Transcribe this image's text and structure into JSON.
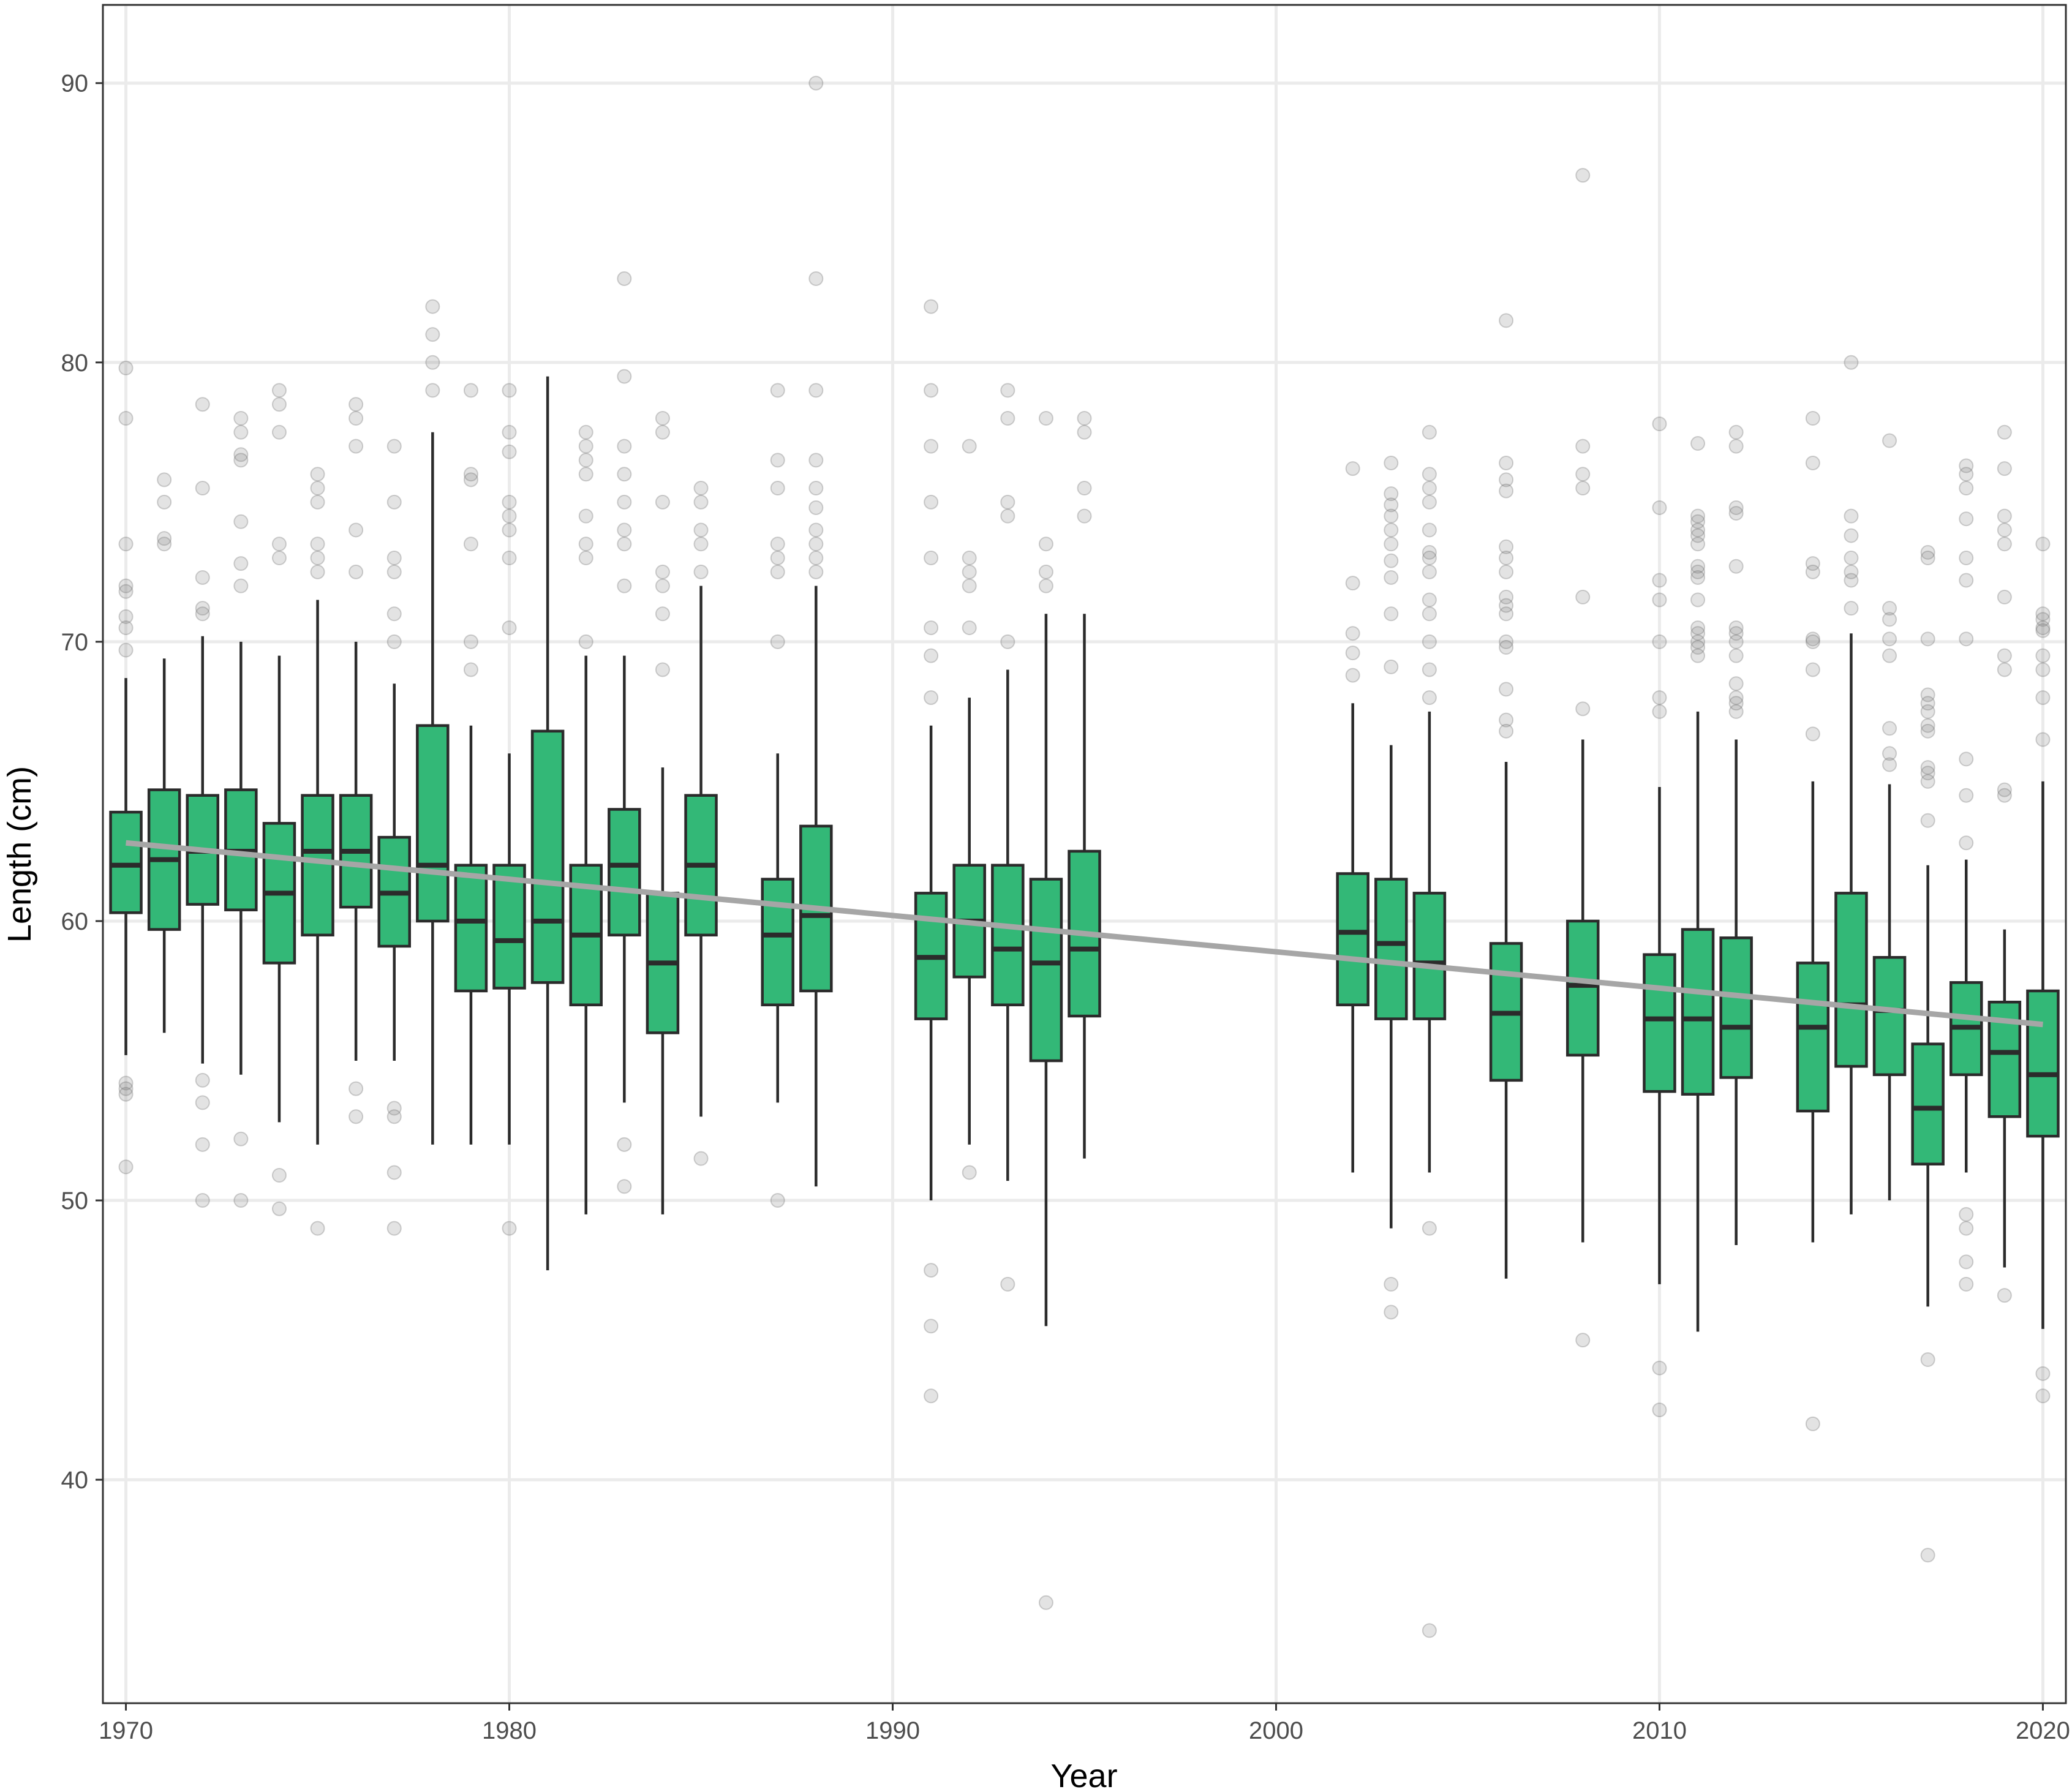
{
  "chart_data": {
    "type": "box",
    "title": "",
    "xlabel": "Year",
    "ylabel": "Length (cm)",
    "xlim": [
      1969.4,
      2020.6
    ],
    "ylim": [
      32,
      92.8
    ],
    "x_ticks": [
      1970,
      1980,
      1990,
      2000,
      2010,
      2020
    ],
    "y_ticks": [
      40,
      50,
      60,
      70,
      80,
      90
    ],
    "grid": true,
    "legend": "none",
    "colors": {
      "box_fill": "#33b877",
      "box_line": "#2b2b2b",
      "trend": "#a6a6a6",
      "outlier": "#bdbdbd",
      "grid": "#ebebeb",
      "panel_border": "#333333"
    },
    "boxes": [
      {
        "year": 1970,
        "q1": 60.3,
        "median": 62.0,
        "q3": 63.9,
        "whisker_low": 55.2,
        "whisker_high": 68.7
      },
      {
        "year": 1971,
        "q1": 59.7,
        "median": 62.2,
        "q3": 64.7,
        "whisker_low": 56.0,
        "whisker_high": 69.4
      },
      {
        "year": 1972,
        "q1": 60.6,
        "median": 62.5,
        "q3": 64.5,
        "whisker_low": 54.9,
        "whisker_high": 70.2
      },
      {
        "year": 1973,
        "q1": 60.4,
        "median": 62.5,
        "q3": 64.7,
        "whisker_low": 54.5,
        "whisker_high": 70.0
      },
      {
        "year": 1974,
        "q1": 58.5,
        "median": 61.0,
        "q3": 63.5,
        "whisker_low": 52.8,
        "whisker_high": 69.5
      },
      {
        "year": 1975,
        "q1": 59.5,
        "median": 62.5,
        "q3": 64.5,
        "whisker_low": 52.0,
        "whisker_high": 71.5
      },
      {
        "year": 1976,
        "q1": 60.5,
        "median": 62.5,
        "q3": 64.5,
        "whisker_low": 55.0,
        "whisker_high": 70.0
      },
      {
        "year": 1977,
        "q1": 59.1,
        "median": 61.0,
        "q3": 63.0,
        "whisker_low": 55.0,
        "whisker_high": 68.5
      },
      {
        "year": 1978,
        "q1": 60.0,
        "median": 62.0,
        "q3": 67.0,
        "whisker_low": 52.0,
        "whisker_high": 77.5
      },
      {
        "year": 1979,
        "q1": 57.5,
        "median": 60.0,
        "q3": 62.0,
        "whisker_low": 52.0,
        "whisker_high": 67.0
      },
      {
        "year": 1980,
        "q1": 57.6,
        "median": 59.3,
        "q3": 62.0,
        "whisker_low": 52.0,
        "whisker_high": 66.0
      },
      {
        "year": 1981,
        "q1": 57.8,
        "median": 60.0,
        "q3": 66.8,
        "whisker_low": 47.5,
        "whisker_high": 79.5
      },
      {
        "year": 1982,
        "q1": 57.0,
        "median": 59.5,
        "q3": 62.0,
        "whisker_low": 49.5,
        "whisker_high": 69.5
      },
      {
        "year": 1983,
        "q1": 59.5,
        "median": 62.0,
        "q3": 64.0,
        "whisker_low": 53.5,
        "whisker_high": 69.5
      },
      {
        "year": 1984,
        "q1": 56.0,
        "median": 58.5,
        "q3": 61.0,
        "whisker_low": 49.5,
        "whisker_high": 65.5
      },
      {
        "year": 1985,
        "q1": 59.5,
        "median": 62.0,
        "q3": 64.5,
        "whisker_low": 53.0,
        "whisker_high": 72.0
      },
      {
        "year": 1987,
        "q1": 57.0,
        "median": 59.5,
        "q3": 61.5,
        "whisker_low": 53.5,
        "whisker_high": 66.0
      },
      {
        "year": 1988,
        "q1": 57.5,
        "median": 60.2,
        "q3": 63.4,
        "whisker_low": 50.5,
        "whisker_high": 72.0
      },
      {
        "year": 1991,
        "q1": 56.5,
        "median": 58.7,
        "q3": 61.0,
        "whisker_low": 50.0,
        "whisker_high": 67.0
      },
      {
        "year": 1992,
        "q1": 58.0,
        "median": 60.0,
        "q3": 62.0,
        "whisker_low": 52.0,
        "whisker_high": 68.0
      },
      {
        "year": 1993,
        "q1": 57.0,
        "median": 59.0,
        "q3": 62.0,
        "whisker_low": 50.7,
        "whisker_high": 69.0
      },
      {
        "year": 1994,
        "q1": 55.0,
        "median": 58.5,
        "q3": 61.5,
        "whisker_low": 45.5,
        "whisker_high": 71.0
      },
      {
        "year": 1995,
        "q1": 56.6,
        "median": 59.0,
        "q3": 62.5,
        "whisker_low": 51.5,
        "whisker_high": 71.0
      },
      {
        "year": 2002,
        "q1": 57.0,
        "median": 59.6,
        "q3": 61.7,
        "whisker_low": 51.0,
        "whisker_high": 67.8
      },
      {
        "year": 2003,
        "q1": 56.5,
        "median": 59.2,
        "q3": 61.5,
        "whisker_low": 49.0,
        "whisker_high": 66.3
      },
      {
        "year": 2004,
        "q1": 56.5,
        "median": 58.5,
        "q3": 61.0,
        "whisker_low": 51.0,
        "whisker_high": 67.5
      },
      {
        "year": 2006,
        "q1": 54.3,
        "median": 56.7,
        "q3": 59.2,
        "whisker_low": 47.2,
        "whisker_high": 65.7
      },
      {
        "year": 2008,
        "q1": 55.2,
        "median": 57.7,
        "q3": 60.0,
        "whisker_low": 48.5,
        "whisker_high": 66.5
      },
      {
        "year": 2010,
        "q1": 53.9,
        "median": 56.5,
        "q3": 58.8,
        "whisker_low": 47.0,
        "whisker_high": 64.8
      },
      {
        "year": 2011,
        "q1": 53.8,
        "median": 56.5,
        "q3": 59.7,
        "whisker_low": 45.3,
        "whisker_high": 67.5
      },
      {
        "year": 2012,
        "q1": 54.4,
        "median": 56.2,
        "q3": 59.4,
        "whisker_low": 48.4,
        "whisker_high": 66.5
      },
      {
        "year": 2014,
        "q1": 53.2,
        "median": 56.2,
        "q3": 58.5,
        "whisker_low": 48.5,
        "whisker_high": 65.0
      },
      {
        "year": 2015,
        "q1": 54.8,
        "median": 57.0,
        "q3": 61.0,
        "whisker_low": 49.5,
        "whisker_high": 70.3
      },
      {
        "year": 2016,
        "q1": 54.5,
        "median": 56.8,
        "q3": 58.7,
        "whisker_low": 50.0,
        "whisker_high": 64.9
      },
      {
        "year": 2017,
        "q1": 51.3,
        "median": 53.3,
        "q3": 55.6,
        "whisker_low": 46.2,
        "whisker_high": 62.0
      },
      {
        "year": 2018,
        "q1": 54.5,
        "median": 56.2,
        "q3": 57.8,
        "whisker_low": 51.0,
        "whisker_high": 62.2
      },
      {
        "year": 2019,
        "q1": 53.0,
        "median": 55.3,
        "q3": 57.1,
        "whisker_low": 47.6,
        "whisker_high": 59.7
      },
      {
        "year": 2020,
        "q1": 52.3,
        "median": 54.5,
        "q3": 57.5,
        "whisker_low": 45.4,
        "whisker_high": 65.0
      }
    ],
    "outliers": [
      {
        "year": 1970,
        "values": [
          79.8,
          78.0,
          73.5,
          72.0,
          71.8,
          70.9,
          70.5,
          69.7,
          54.2,
          54.0,
          53.8,
          51.2
        ]
      },
      {
        "year": 1971,
        "values": [
          75.8,
          75.0,
          73.7,
          73.5
        ]
      },
      {
        "year": 1972,
        "values": [
          78.5,
          75.5,
          72.3,
          71.2,
          71.0,
          54.3,
          53.5,
          52.0,
          50.0
        ]
      },
      {
        "year": 1973,
        "values": [
          78.0,
          77.5,
          76.7,
          76.5,
          74.3,
          72.8,
          72.0,
          52.2,
          50.0
        ]
      },
      {
        "year": 1974,
        "values": [
          79.0,
          78.5,
          77.5,
          73.5,
          73.0,
          50.9,
          49.7
        ]
      },
      {
        "year": 1975,
        "values": [
          76.0,
          75.5,
          75.0,
          73.5,
          73.0,
          72.5,
          49.0
        ]
      },
      {
        "year": 1976,
        "values": [
          78.5,
          78.0,
          77.0,
          74.0,
          72.5,
          54.0,
          53.0
        ]
      },
      {
        "year": 1977,
        "values": [
          77.0,
          75.0,
          73.0,
          72.5,
          71.0,
          70.0,
          53.3,
          53.0,
          51.0,
          49.0
        ]
      },
      {
        "year": 1978,
        "values": [
          82.0,
          81.0,
          80.0,
          79.0
        ]
      },
      {
        "year": 1979,
        "values": [
          79.0,
          76.0,
          75.8,
          73.5,
          70.0,
          69.0
        ]
      },
      {
        "year": 1980,
        "values": [
          79.0,
          77.5,
          76.8,
          75.0,
          74.5,
          74.0,
          73.0,
          70.5,
          49.0
        ]
      },
      {
        "year": 1982,
        "values": [
          77.5,
          77.0,
          76.5,
          76.0,
          74.5,
          73.5,
          73.0,
          70.0
        ]
      },
      {
        "year": 1983,
        "values": [
          83.0,
          79.5,
          77.0,
          76.0,
          75.0,
          74.0,
          73.5,
          72.0,
          52.0,
          50.5
        ]
      },
      {
        "year": 1984,
        "values": [
          78.0,
          77.5,
          75.0,
          72.5,
          72.0,
          71.0,
          69.0
        ]
      },
      {
        "year": 1985,
        "values": [
          75.5,
          75.0,
          74.0,
          73.5,
          72.5,
          51.5
        ]
      },
      {
        "year": 1987,
        "values": [
          79.0,
          76.5,
          75.5,
          73.5,
          73.0,
          72.5,
          70.0,
          50.0
        ]
      },
      {
        "year": 1988,
        "values": [
          90.0,
          83.0,
          79.0,
          76.5,
          75.5,
          74.8,
          74.0,
          73.5,
          73.0,
          72.5
        ]
      },
      {
        "year": 1991,
        "values": [
          82.0,
          79.0,
          77.0,
          75.0,
          73.0,
          70.5,
          69.5,
          68.0,
          47.5,
          45.5,
          43.0
        ]
      },
      {
        "year": 1992,
        "values": [
          77.0,
          73.0,
          72.5,
          72.0,
          70.5,
          51.0
        ]
      },
      {
        "year": 1993,
        "values": [
          79.0,
          78.0,
          75.0,
          74.5,
          70.0,
          47.0
        ]
      },
      {
        "year": 1994,
        "values": [
          78.0,
          73.5,
          72.5,
          72.0,
          35.6
        ]
      },
      {
        "year": 1995,
        "values": [
          78.0,
          77.5,
          75.5,
          74.5
        ]
      },
      {
        "year": 2002,
        "values": [
          76.2,
          72.1,
          70.3,
          69.6,
          68.8
        ]
      },
      {
        "year": 2003,
        "values": [
          76.4,
          75.3,
          74.9,
          74.5,
          74.0,
          73.5,
          72.9,
          72.3,
          71.0,
          69.1,
          47.0,
          46.0
        ]
      },
      {
        "year": 2004,
        "values": [
          77.5,
          76.0,
          75.5,
          75.0,
          74.0,
          73.2,
          73.0,
          72.5,
          71.5,
          71.0,
          70.0,
          69.0,
          68.0,
          49.0,
          34.6
        ]
      },
      {
        "year": 2006,
        "values": [
          81.5,
          76.4,
          75.8,
          75.4,
          73.4,
          73.0,
          72.5,
          71.6,
          71.3,
          71.0,
          70.0,
          69.8,
          68.3,
          67.2,
          66.8
        ]
      },
      {
        "year": 2008,
        "values": [
          86.7,
          77.0,
          76.0,
          75.5,
          71.6,
          67.6,
          45.0
        ]
      },
      {
        "year": 2010,
        "values": [
          77.8,
          74.8,
          72.2,
          71.5,
          70.0,
          68.0,
          67.5,
          44.0,
          42.5
        ]
      },
      {
        "year": 2011,
        "values": [
          77.1,
          74.5,
          74.3,
          74.0,
          73.8,
          73.5,
          72.7,
          72.5,
          72.3,
          71.5,
          70.5,
          70.3,
          70.0,
          69.8,
          69.5
        ]
      },
      {
        "year": 2012,
        "values": [
          77.5,
          77.0,
          74.8,
          74.6,
          72.7,
          70.5,
          70.3,
          70.0,
          69.5,
          68.5,
          68.0,
          67.8,
          67.5
        ]
      },
      {
        "year": 2014,
        "values": [
          78.0,
          76.4,
          72.8,
          72.5,
          70.1,
          70.0,
          69.0,
          66.7,
          42.0
        ]
      },
      {
        "year": 2015,
        "values": [
          80.0,
          74.5,
          73.8,
          73.0,
          72.5,
          72.2,
          71.2
        ]
      },
      {
        "year": 2016,
        "values": [
          77.2,
          71.2,
          70.8,
          70.1,
          69.5,
          66.9,
          66.0,
          65.6
        ]
      },
      {
        "year": 2017,
        "values": [
          73.2,
          73.0,
          70.1,
          68.1,
          67.8,
          67.5,
          67.0,
          66.8,
          65.5,
          65.3,
          65.0,
          63.6,
          44.3,
          37.3
        ]
      },
      {
        "year": 2018,
        "values": [
          76.3,
          76.0,
          75.5,
          74.4,
          73.0,
          72.2,
          70.1,
          65.8,
          64.5,
          62.8,
          49.5,
          49.0,
          47.8,
          47.0
        ]
      },
      {
        "year": 2019,
        "values": [
          77.5,
          76.2,
          74.5,
          74.0,
          73.5,
          71.6,
          69.5,
          69.0,
          64.7,
          64.5,
          46.6
        ]
      },
      {
        "year": 2020,
        "values": [
          73.5,
          71.0,
          70.8,
          70.5,
          70.4,
          69.5,
          69.0,
          68.0,
          66.5,
          43.8,
          43.0
        ]
      }
    ],
    "trend": {
      "type": "line",
      "x": [
        1970,
        2020
      ],
      "y": [
        62.8,
        56.3
      ]
    }
  }
}
